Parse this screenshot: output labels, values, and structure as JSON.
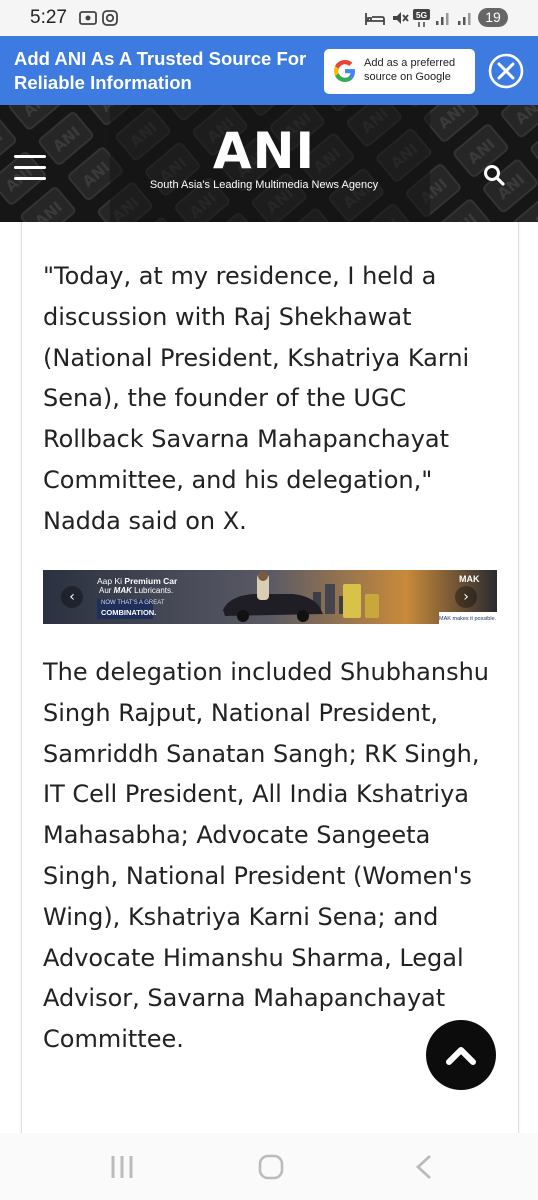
{
  "status_bar": {
    "time": "5:27",
    "network": "5G",
    "battery": "19"
  },
  "trusted_banner": {
    "text": "Add ANI As A Trusted Source For Reliable Information",
    "button_line1": "Add as a preferred",
    "button_line2": "source on Google"
  },
  "header": {
    "logo": "ANI",
    "tagline": "South Asia's Leading Multimedia News Agency"
  },
  "article": {
    "paragraph1": "\"Today, at my residence, I held a discussion with Raj Shekhawat (National President, Kshatriya Karni Sena), the founder of the UGC Rollback Savarna Mahapanchayat Committee, and his delegation,\" Nadda said on X.",
    "paragraph2": "The delegation included Shubhanshu Singh Rajput, National President, Samriddh Sanatan Sangh; RK Singh, IT Cell President, All India Kshatriya Mahasabha; Advocate Sangeeta Singh, National President (Women's Wing), Kshatriya Karni Sena; and Advocate Himanshu Sharma, Legal Advisor, Savarna Mahapanchayat Committee."
  },
  "ad": {
    "line1_prefix": "Aap Ki ",
    "line1_bold": "Premium Car",
    "line2_prefix": "Aur ",
    "line2_bold": "MAK",
    "line2_suffix": " Lubricants.",
    "line3": "NOW THAT'S A GREAT",
    "line4": "COMBINATION.",
    "brand": "MAK",
    "slogan": "MAK makes it possible."
  },
  "colors": {
    "banner_blue": "#3d7be0",
    "header_black": "#161616",
    "text": "#222222"
  },
  "icons": {
    "menu": "hamburger-menu-icon",
    "search": "search-icon",
    "close": "close-icon",
    "scroll_top": "chevron-up-icon"
  }
}
